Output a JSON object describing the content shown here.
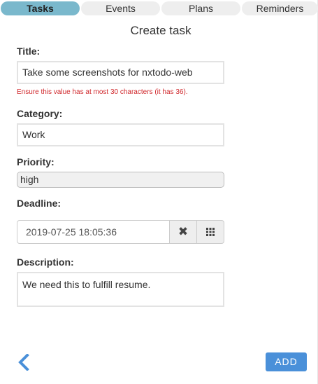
{
  "tabs": [
    {
      "label": "Tasks",
      "active": true
    },
    {
      "label": "Events",
      "active": false
    },
    {
      "label": "Plans",
      "active": false
    },
    {
      "label": "Reminders",
      "active": false
    }
  ],
  "form": {
    "heading": "Create task",
    "title": {
      "label": "Title:",
      "value": "Take some screenshots for nxtodo-web",
      "error": "Ensure this value has at most 30 characters (it has 36)."
    },
    "category": {
      "label": "Category:",
      "value": "Work"
    },
    "priority": {
      "label": "Priority:",
      "value": "high"
    },
    "deadline": {
      "label": "Deadline:",
      "value": "2019-07-25 18:05:36",
      "clear_icon": "close-icon",
      "picker_icon": "calendar-grid-icon"
    },
    "description": {
      "label": "Description:",
      "value": "We need this to fulfill resume."
    }
  },
  "actions": {
    "back_icon": "chevron-left-icon",
    "add_label": "ADD"
  },
  "colors": {
    "active_tab": "#7ab8cc",
    "accent": "#4a90d9",
    "error": "#d0282c"
  }
}
